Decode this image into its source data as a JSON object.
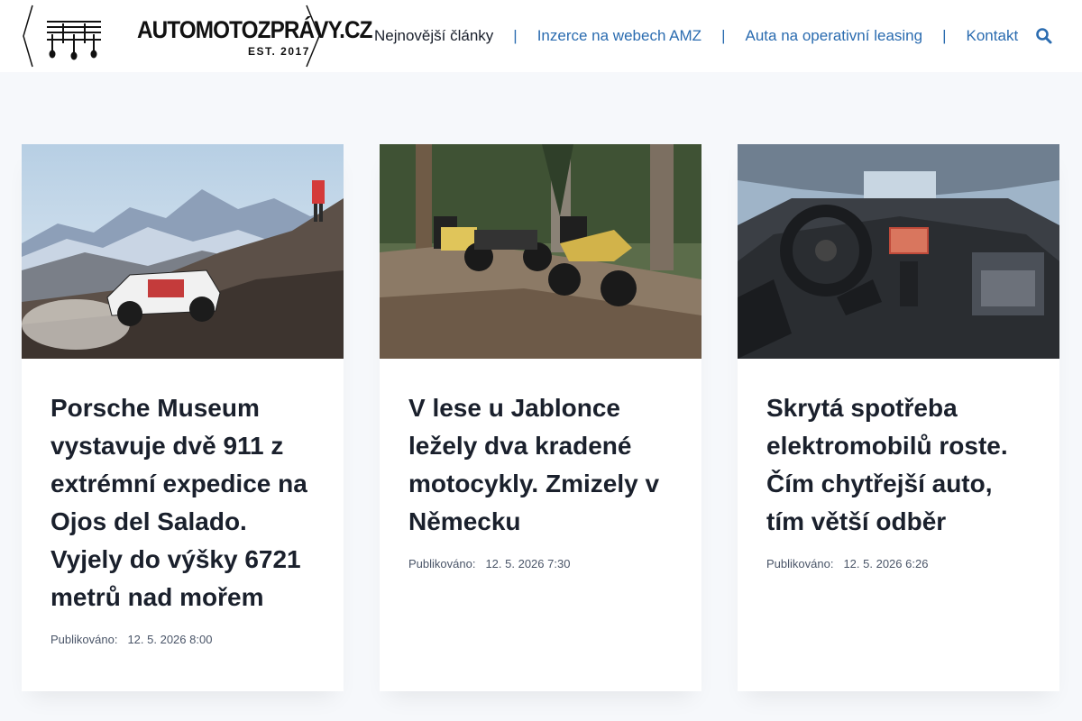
{
  "site": {
    "logo_text": "AUTOMOTOZPRÁVY.CZ",
    "logo_est": "EST. 2017"
  },
  "nav": {
    "items": [
      {
        "label": "Nejnovější články"
      },
      {
        "label": "Inzerce na webech AMZ"
      },
      {
        "label": "Auta na operativní leasing"
      },
      {
        "label": "Kontakt"
      }
    ],
    "separator": "|"
  },
  "colors": {
    "link": "#2b6cb0",
    "text": "#1a202c",
    "background": "#f6f8fb"
  },
  "articles": [
    {
      "title": "Porsche Museum vystavuje dvě 911 z extrémní expedice na Ojos del Salado. Vyjely do výšky 6721 metrů nad mořem",
      "meta_label": "Publikováno:",
      "date": "12. 5. 2026 8:00"
    },
    {
      "title": "V lese u Jablonce ležely dva kradené motocykly. Zmizely v Německu",
      "meta_label": "Publikováno:",
      "date": "12. 5. 2026 7:30"
    },
    {
      "title": "Skrytá spotřeba elektromobilů roste. Čím chytřejší auto, tím větší odběr",
      "meta_label": "Publikováno:",
      "date": "12. 5. 2026 6:26"
    }
  ]
}
